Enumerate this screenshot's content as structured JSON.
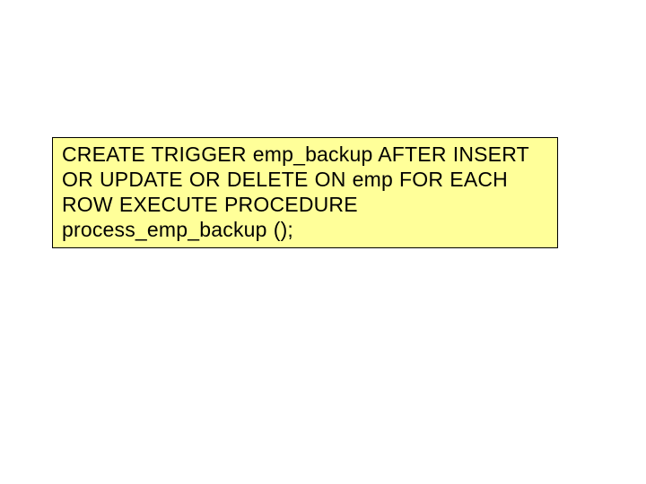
{
  "code_box": {
    "line1": "CREATE TRIGGER emp_backup AFTER INSERT",
    "line2": "OR UPDATE OR DELETE ON emp FOR EACH",
    "line3": "ROW EXECUTE PROCEDURE",
    "line4": "process_emp_backup ();"
  }
}
